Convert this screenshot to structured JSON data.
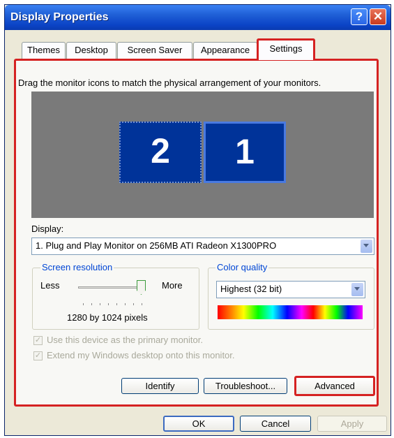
{
  "window": {
    "title": "Display Properties",
    "help_glyph": "?",
    "close_glyph": "✕"
  },
  "tabs": [
    "Themes",
    "Desktop",
    "Screen Saver",
    "Appearance",
    "Settings"
  ],
  "settings": {
    "instruction": "Drag the monitor icons to match the physical arrangement of your monitors.",
    "monitors": [
      "2",
      "1"
    ],
    "display_label": "Display:",
    "display_value": "1. Plug and Play Monitor on 256MB ATI Radeon X1300PRO",
    "resolution": {
      "group_label": "Screen resolution",
      "less": "Less",
      "more": "More",
      "value_text": "1280 by 1024 pixels",
      "slider_position": 1.0
    },
    "color_quality": {
      "group_label": "Color quality",
      "value": "Highest (32 bit)"
    },
    "checkboxes": [
      {
        "label": "Use this device as the primary monitor.",
        "checked": true,
        "enabled": false
      },
      {
        "label": "Extend my Windows desktop onto this monitor.",
        "checked": true,
        "enabled": false
      }
    ],
    "buttons": {
      "identify": "Identify",
      "troubleshoot": "Troubleshoot...",
      "advanced": "Advanced"
    }
  },
  "footer": {
    "ok": "OK",
    "cancel": "Cancel",
    "apply": "Apply"
  },
  "colors": {
    "title_bar": "#0b43c6",
    "highlight": "#d52222",
    "monitor_fill": "#003399",
    "dialog_bg": "#ece9d8"
  }
}
